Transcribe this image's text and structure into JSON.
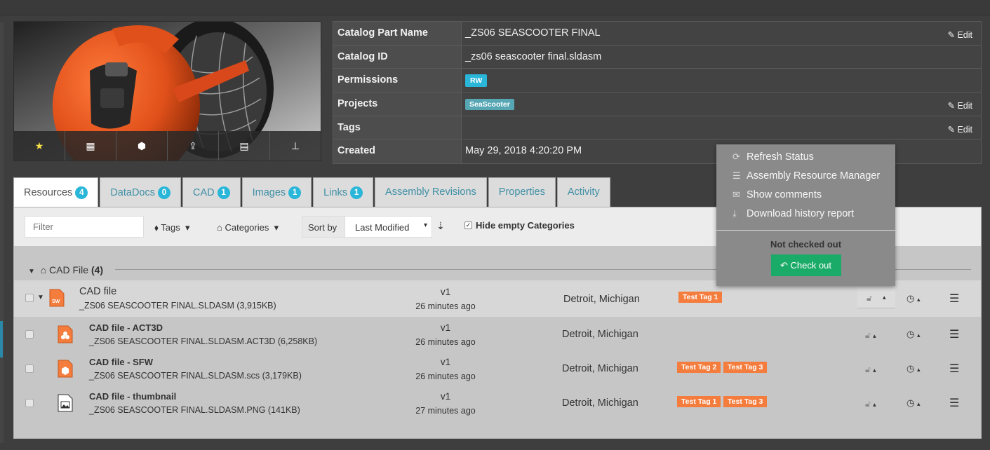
{
  "info": {
    "rows": [
      {
        "label": "Catalog Part Name",
        "value": "_ZS06 SEASCOOTER FINAL",
        "edit": "Edit"
      },
      {
        "label": "Catalog ID",
        "value": "_zs06 seascooter final.sldasm"
      },
      {
        "label": "Permissions",
        "pill": "RW"
      },
      {
        "label": "Projects",
        "pill": "SeaScooter",
        "edit": "Edit"
      },
      {
        "label": "Tags",
        "value": "",
        "edit": "Edit"
      },
      {
        "label": "Created",
        "value": "May 29, 2018 4:20:20 PM"
      }
    ]
  },
  "preview_toolbar": [
    {
      "icon": "star-icon",
      "glyph": "★"
    },
    {
      "icon": "table-icon",
      "glyph": "▦"
    },
    {
      "icon": "cube-icon",
      "glyph": "⬢"
    },
    {
      "icon": "upload-icon",
      "glyph": "⇪"
    },
    {
      "icon": "document-icon",
      "glyph": "▤"
    },
    {
      "icon": "pin-icon",
      "glyph": "⊥"
    }
  ],
  "tabs": [
    {
      "label": "Resources",
      "badge": "4",
      "active": true
    },
    {
      "label": "DataDocs",
      "badge": "0"
    },
    {
      "label": "CAD",
      "badge": "1"
    },
    {
      "label": "Images",
      "badge": "1"
    },
    {
      "label": "Links",
      "badge": "1"
    },
    {
      "label": "Assembly Revisions"
    },
    {
      "label": "Properties"
    },
    {
      "label": "Activity"
    }
  ],
  "toolbar": {
    "filter_placeholder": "Filter",
    "tags_label": "Tags",
    "categories_label": "Categories",
    "sort_by_label": "Sort by",
    "sort_value": "Last Modified",
    "hide_empty_label": "Hide empty Categories"
  },
  "group": {
    "label": "CAD File",
    "count": "(4)"
  },
  "resources": [
    {
      "name": "CAD file",
      "file": "_ZS06 SEASCOOTER FINAL.SLDASM (3,915KB)",
      "version": "v1",
      "ago": "26 minutes ago",
      "location": "Detroit, Michigan",
      "tags": [
        "Test Tag 1"
      ],
      "icon": "sw-file-icon"
    },
    {
      "name": "CAD file - ACT3D",
      "file": "_ZS06 SEASCOOTER FINAL.SLDASM.ACT3D (6,258KB)",
      "version": "v1",
      "ago": "26 minutes ago",
      "location": "Detroit, Michigan",
      "tags": [],
      "icon": "act3d-file-icon"
    },
    {
      "name": "CAD file - SFW",
      "file": "_ZS06 SEASCOOTER FINAL.SLDASM.scs (3,179KB)",
      "version": "v1",
      "ago": "26 minutes ago",
      "location": "Detroit, Michigan",
      "tags": [
        "Test Tag 2",
        "Test Tag 3"
      ],
      "icon": "sfw-file-icon"
    },
    {
      "name": "CAD file - thumbnail",
      "file": "_ZS06 SEASCOOTER FINAL.SLDASM.PNG (141KB)",
      "version": "v1",
      "ago": "27 minutes ago",
      "location": "Detroit, Michigan",
      "tags": [
        "Test Tag 1",
        "Test Tag 3"
      ],
      "icon": "image-file-icon"
    }
  ],
  "dropdown": {
    "items": [
      {
        "label": "Refresh Status",
        "glyph": "⟳"
      },
      {
        "label": "Assembly Resource Manager",
        "glyph": "☰"
      },
      {
        "label": "Show comments",
        "glyph": "✉"
      },
      {
        "label": "Download history report",
        "glyph": "⤓"
      }
    ],
    "status": "Not checked out",
    "checkout_label": "Check out"
  },
  "glyphs": {
    "edit": "✎",
    "lock": "🔓︎",
    "history": "◷",
    "menu": "☰",
    "caret": "▴",
    "chevron": "▾",
    "tag": "⬧",
    "inbox": "⌂",
    "sort": "⇣"
  },
  "colors": {
    "accent": "#29b6d8",
    "tag": "#f47c3c",
    "checkout": "#1bab68",
    "tab_text": "#3f8fa5"
  }
}
